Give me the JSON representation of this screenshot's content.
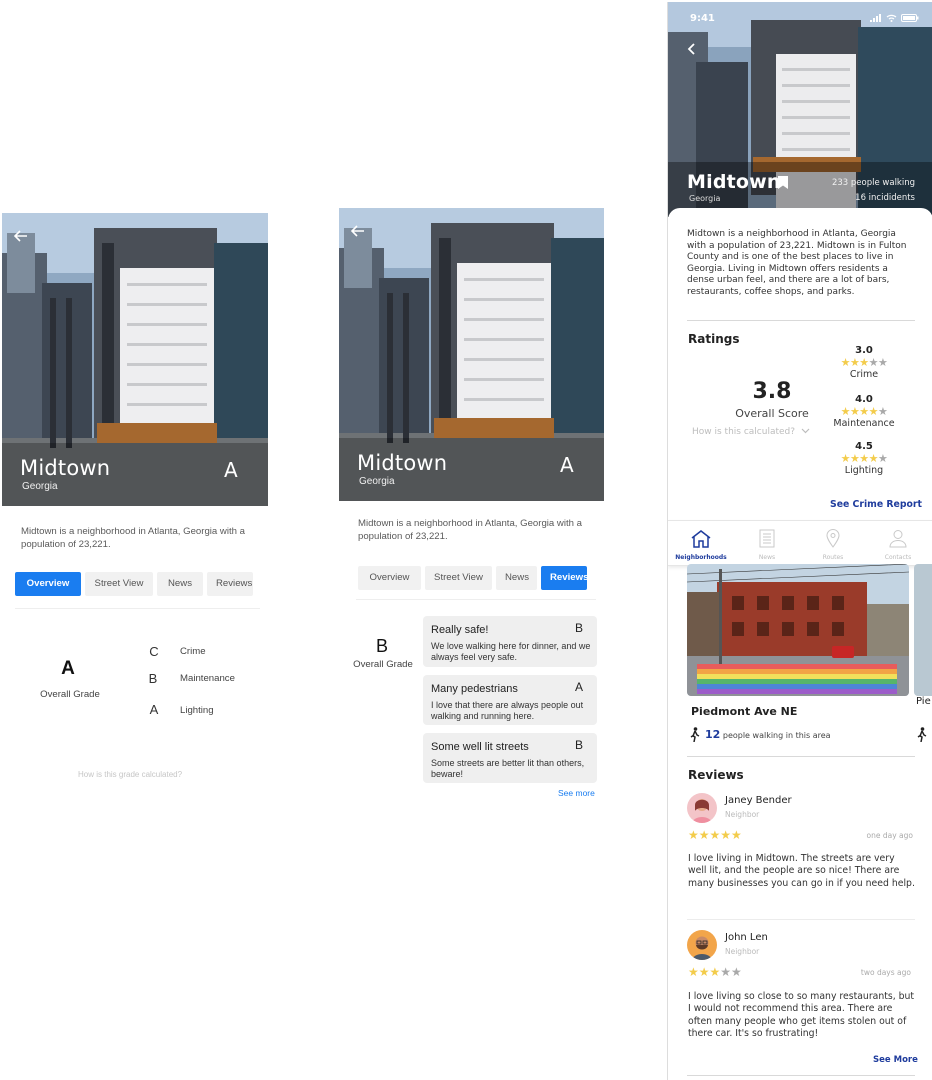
{
  "neighborhood": {
    "name": "Midtown",
    "state": "Georgia",
    "grade": "A",
    "description_short": "Midtown is a neighborhood in Atlanta, Georgia with a population of 23,221."
  },
  "screen1": {
    "tabs": [
      "Overview",
      "Street View",
      "News",
      "Reviews"
    ],
    "active_tab": "Overview",
    "overall_grade": "A",
    "overall_grade_label": "Overall Grade",
    "categories": [
      {
        "grade": "C",
        "label": "Crime"
      },
      {
        "grade": "B",
        "label": "Maintenance"
      },
      {
        "grade": "A",
        "label": "Lighting"
      }
    ],
    "calc_link": "How is this grade calculated?"
  },
  "screen2": {
    "tabs": [
      "Overview",
      "Street View",
      "News",
      "Reviews"
    ],
    "active_tab": "Reviews",
    "overall_grade": "B",
    "overall_grade_label": "Overall Grade",
    "reviews": [
      {
        "title": "Really safe!",
        "grade": "B",
        "body": "We love walking here for dinner, and we always feel very safe."
      },
      {
        "title": "Many pedestrians",
        "grade": "A",
        "body": "I love that there are always people out walking and running here."
      },
      {
        "title": "Some well lit streets",
        "grade": "B",
        "body": "Some streets are better lit than others, beware!"
      }
    ],
    "see_more": "See more"
  },
  "screen3": {
    "status_time": "9:41",
    "title": "Midtown",
    "subtitle": "Georgia",
    "people_walking": "233 people walking",
    "incidents": "16 incididents",
    "description": "Midtown is a neighborhood in Atlanta, Georgia with a population of 23,221. Midtown is in Fulton County and is one of the best places to live in Georgia. Living in Midtown offers residents a dense urban feel, and there are a lot of bars, restaurants, coffee shops, and parks.",
    "ratings_heading": "Ratings",
    "overall_score": "3.8",
    "overall_score_label": "Overall Score",
    "calc_link": "How is this calculated?",
    "ratings": [
      {
        "value": "3.0",
        "stars": 3,
        "label": "Crime"
      },
      {
        "value": "4.0",
        "stars": 4,
        "label": "Maintenance"
      },
      {
        "value": "4.5",
        "stars": 4,
        "label": "Lighting"
      }
    ],
    "crime_report_link": "See Crime Report",
    "nav": [
      {
        "label": "Neighborhoods",
        "icon": "home-icon"
      },
      {
        "label": "News",
        "icon": "news-icon"
      },
      {
        "label": "Routes",
        "icon": "map-pin-icon"
      },
      {
        "label": "Contacts",
        "icon": "person-icon"
      }
    ],
    "street": {
      "name": "Piedmont Ave NE",
      "next_name_partial": "Pie",
      "walking_count": "12",
      "walking_text": "people walking in this area"
    },
    "reviews_heading": "Reviews",
    "reviews": [
      {
        "name": "Janey Bender",
        "role": "Neighbor",
        "stars": 5,
        "time": "one day ago",
        "text": "I love living in Midtown. The streets are very well lit, and the people are so nice! There are many businesses you can go in if you need help."
      },
      {
        "name": "John Len",
        "role": "Neighbor",
        "stars": 3,
        "time": "two days ago",
        "text": "I love living so close to so many restaurants, but I would not recommend this area. There are often many people who get items stolen out of there car. It's so frustrating!"
      }
    ],
    "see_more": "See More",
    "colors": {
      "accent_blue": "#1a7df0",
      "link_navy": "#1f3c9d",
      "star_gold": "#f3cc4b"
    }
  }
}
